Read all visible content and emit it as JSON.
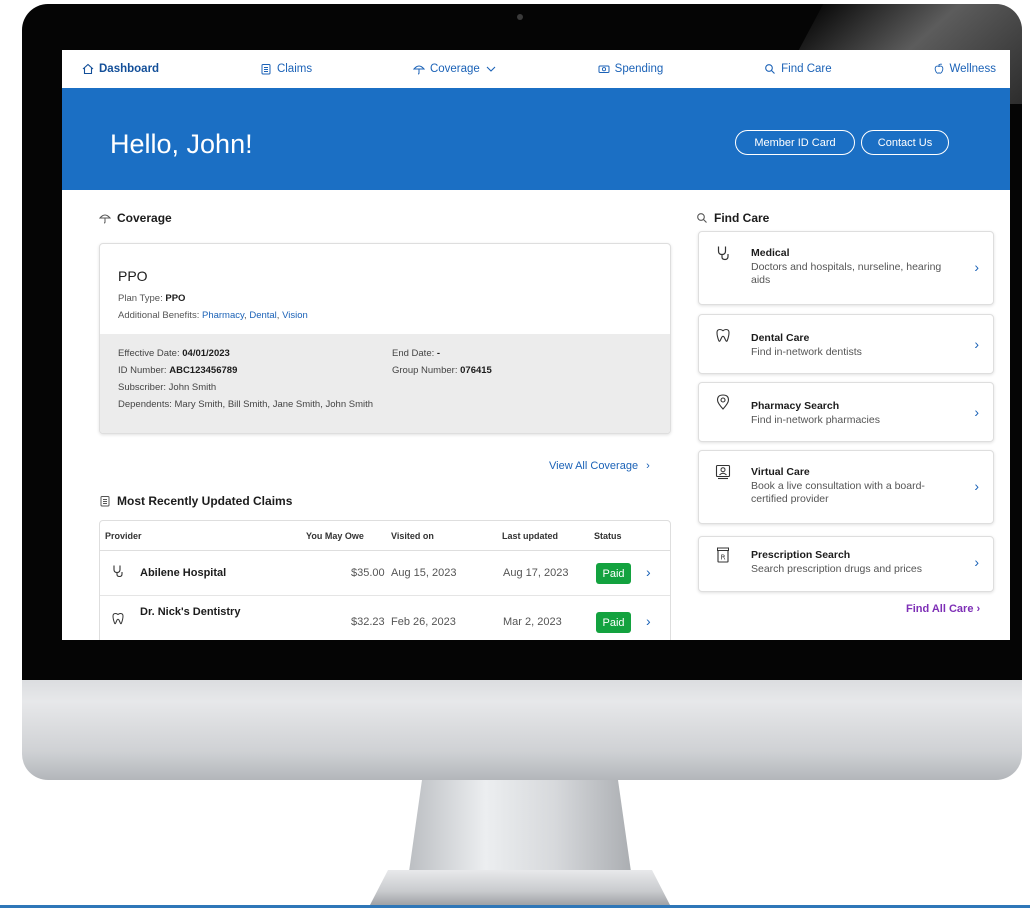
{
  "nav": {
    "dashboard": "Dashboard",
    "claims": "Claims",
    "coverage": "Coverage",
    "spending": "Spending",
    "find_care": "Find Care",
    "wellness": "Wellness"
  },
  "hero": {
    "greeting": "Hello, John!",
    "member_id_button": "Member ID Card",
    "contact_button": "Contact Us"
  },
  "coverage": {
    "section_title": "Coverage",
    "plan_name": "PPO",
    "plan_type_label": "Plan Type:",
    "plan_type": "PPO",
    "benefits_label": "Additional Benefits:",
    "benefits": [
      "Pharmacy",
      "Dental",
      "Vision"
    ],
    "effective_label": "Effective Date:",
    "effective_date": "04/01/2023",
    "end_label": "End Date:",
    "end_date": "-",
    "id_label": "ID Number:",
    "id_number": "ABC123456789",
    "group_label": "Group Number:",
    "group_number": "076415",
    "subscriber": "Subscriber: John Smith",
    "dependents": "Dependents: Mary Smith, Bill Smith, Jane Smith, John Smith",
    "view_all": "View All Coverage"
  },
  "claims": {
    "section_title": "Most Recently Updated Claims",
    "headers": [
      "Provider",
      "You May Owe",
      "Visited on",
      "Last updated",
      "Status"
    ],
    "rows": [
      {
        "provider": "Abilene Hospital",
        "owe": "$35.00",
        "visited": "Aug 15, 2023",
        "updated": "Aug 17, 2023",
        "status": "Paid",
        "icon": "stethoscope-icon"
      },
      {
        "provider": "Dr. Nick's Dentistry",
        "owe": "$32.23",
        "visited": "Feb 26, 2023",
        "updated": "Mar 2, 2023",
        "status": "Paid",
        "icon": "tooth-icon"
      }
    ]
  },
  "find_care": {
    "section_title": "Find Care",
    "cards": [
      {
        "title": "Medical",
        "desc": "Doctors and hospitals, nurseline, hearing aids",
        "icon": "stethoscope-icon"
      },
      {
        "title": "Dental Care",
        "desc": "Find in-network dentists",
        "icon": "tooth-icon"
      },
      {
        "title": "Pharmacy Search",
        "desc": "Find in-network pharmacies",
        "icon": "location-pin-icon"
      },
      {
        "title": "Virtual Care",
        "desc": "Book a live consultation with a board-certified provider",
        "icon": "video-call-icon"
      },
      {
        "title": "Prescription Search",
        "desc": "Search prescription drugs and prices",
        "icon": "prescription-icon"
      }
    ],
    "find_all": "Find All Care"
  },
  "colors": {
    "brand_blue": "#1b6fc4",
    "link_blue": "#1b62b7",
    "paid_green": "#13a23f",
    "accent_purple": "#7e2fb6"
  }
}
